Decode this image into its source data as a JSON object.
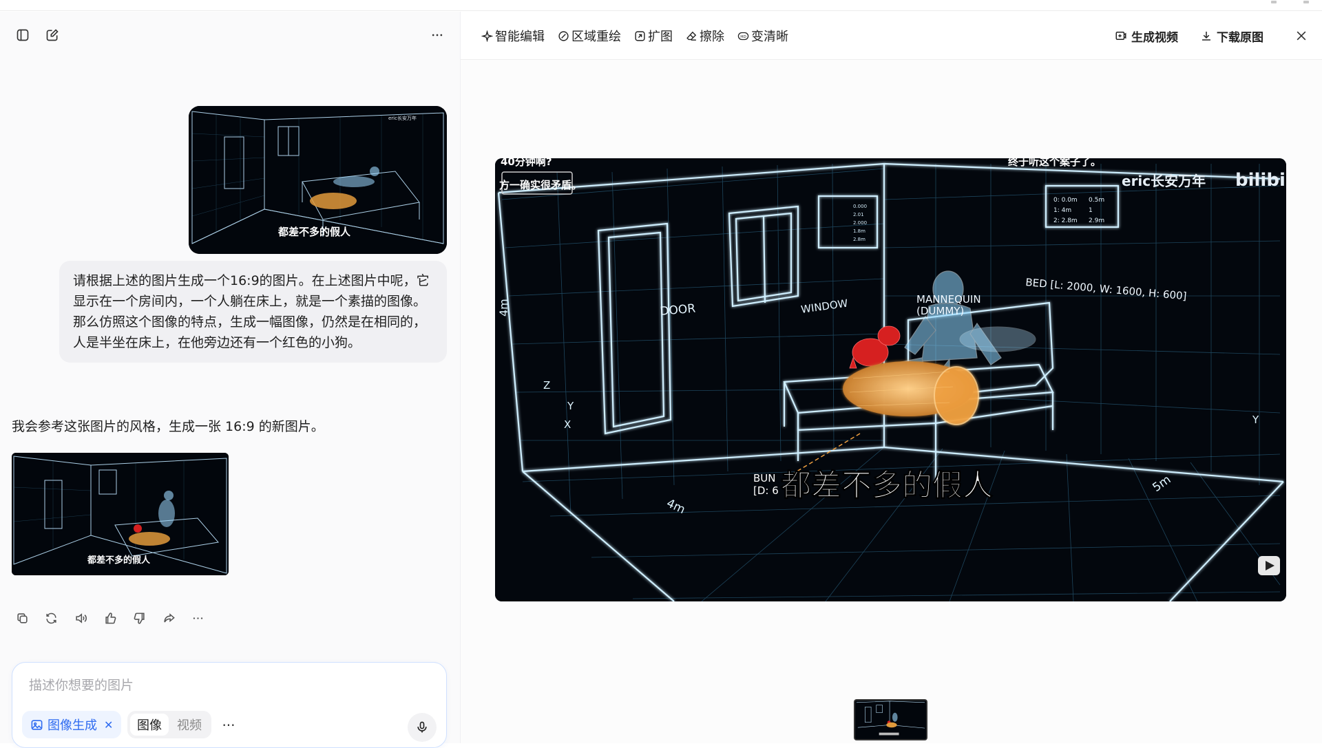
{
  "sidebar_header": {
    "toggle_icon": "sidebar-toggle-icon",
    "new_chat_icon": "new-chat-icon",
    "more_icon": "more-horizontal-icon"
  },
  "conversation": {
    "user_message": "请根据上述的图片生成一个16:9的图片。在上述图片中呢，它显示在一个房间内，一个人躺在床上，就是一个素描的图像。那么仿照这个图像的特点，生成一幅图像，仍然是在相同的，人是半坐在床上，在他旁边还有一个红色的小狗。",
    "assistant_message": "我会参考这张图片的风格，生成一张 16:9 的新图片。"
  },
  "image_text": {
    "top_left": "40分钟啊?",
    "top_banner": "方一确实很矛盾。",
    "top_right": "终于听这个案子了。",
    "watermark": "eric长安万年",
    "brand": "bilibili",
    "info_box_1": [
      "0: 0.0m",
      "1: 4m",
      "2: 2.8m"
    ],
    "info_box_1b": [
      "0.5m",
      "1",
      "2.9m"
    ],
    "info_box_2": [
      "0.000",
      "2.01",
      "2.000",
      "1.8m",
      "2.8m"
    ],
    "door": "DOOR",
    "window": "WINDOW",
    "bed_dims": "BED [L: 2000, W: 1600, H: 600]",
    "mannequin": "MANNEQUIN",
    "dummy": "(DUMMY)",
    "height_4m": "4m",
    "floor_4m": "4m",
    "floor_5m": "5m",
    "axis_z": "Z",
    "axis_y": "Y",
    "axis_x": "X",
    "axis_y_right": "Y",
    "bun": "BUN",
    "bun_d": "[D: 6",
    "subtitle": "都差不多的假人",
    "subtitle_user": "都差不多的假人"
  },
  "composer": {
    "placeholder": "描述你想要的图片",
    "mode_chip": "图像生成",
    "seg_image": "图像",
    "seg_video": "视频",
    "more": "···"
  },
  "toolbar": {
    "smart_edit": "智能编辑",
    "region_redraw": "区域重绘",
    "expand": "扩图",
    "erase": "擦除",
    "hd": "变清晰",
    "gen_video": "生成视频",
    "download": "下载原图"
  },
  "colors": {
    "accent": "#2f6bf0",
    "wire": "#cfefff",
    "wire_glow": "#5fc8ff",
    "bun": "#f0a040",
    "dog": "#d62020"
  }
}
